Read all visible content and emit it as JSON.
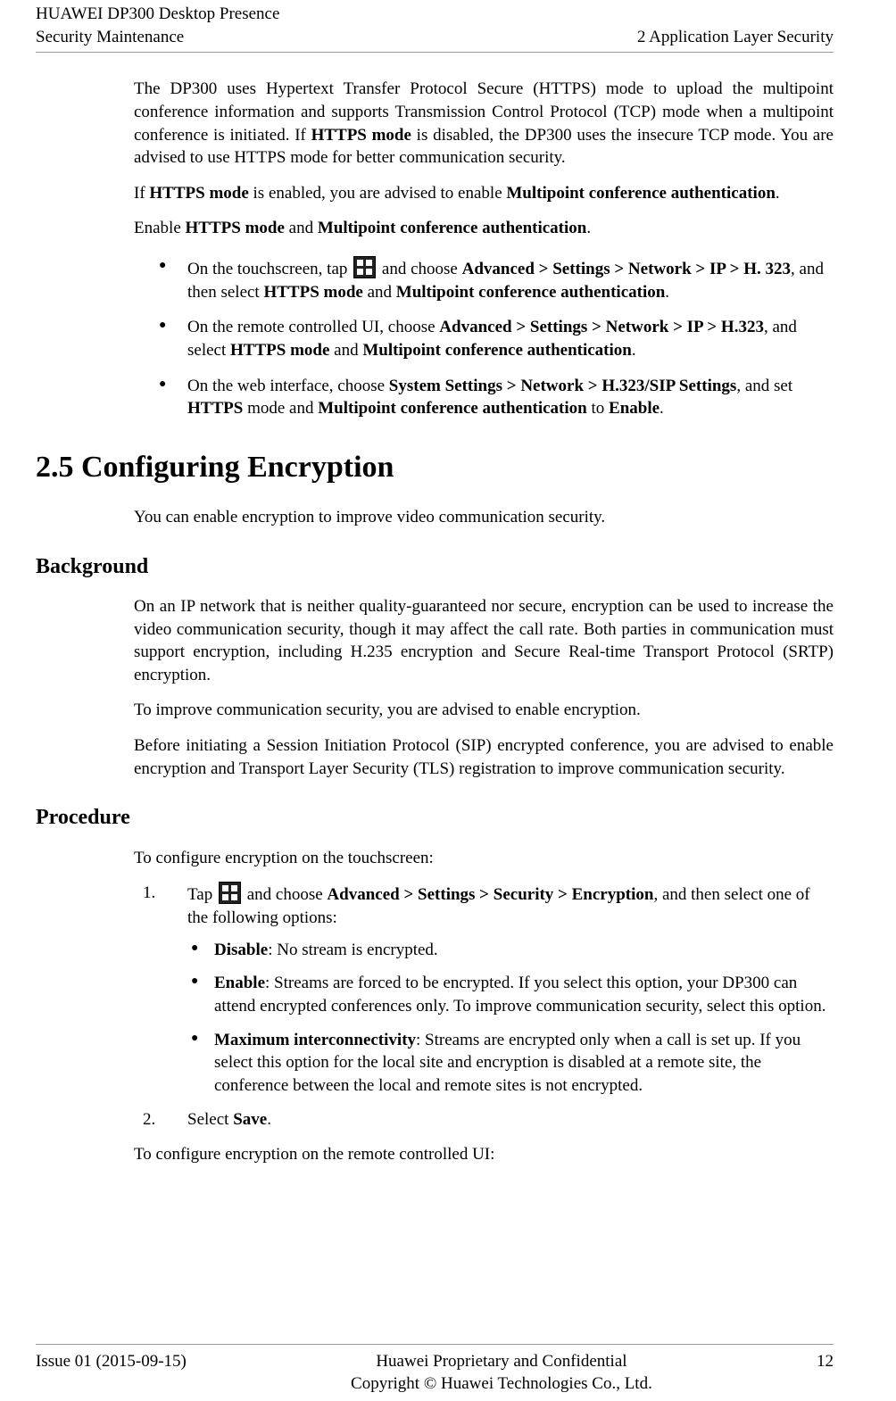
{
  "header": {
    "left_line1": "HUAWEI DP300 Desktop Presence",
    "left_line2": "Security Maintenance",
    "right": "2 Application Layer Security"
  },
  "para": {
    "p1_a": "The DP300 uses Hypertext Transfer Protocol Secure (HTTPS) mode to upload the multipoint conference information and supports Transmission Control Protocol (TCP) mode when a multipoint conference is initiated. If ",
    "p1_b_bold": "HTTPS mode",
    "p1_c": " is disabled, the DP300 uses the insecure TCP mode. You are advised to use HTTPS mode for better communication security.",
    "p2_a": "If ",
    "p2_b_bold": "HTTPS mode",
    "p2_c": " is enabled, you are advised to enable ",
    "p2_d_bold": "Multipoint conference authentication",
    "p2_e": ".",
    "p3_a": "Enable ",
    "p3_b_bold": "HTTPS mode",
    "p3_c": " and ",
    "p3_d_bold": "Multipoint conference authentication",
    "p3_e": "."
  },
  "bullets_top": {
    "b1_a": "On the touchscreen, tap ",
    "b1_b": " and choose ",
    "b1_nav": "Advanced > Settings > Network > IP > H. 323",
    "b1_c": ", and then select ",
    "b1_d_bold": "HTTPS mode",
    "b1_e": " and ",
    "b1_f_bold": "Multipoint conference authentication",
    "b1_g": ".",
    "b2_a": "On the remote controlled UI, choose ",
    "b2_nav": "Advanced > Settings > Network > IP > H.323",
    "b2_b": ", and select ",
    "b2_c_bold": "HTTPS mode",
    "b2_d": " and ",
    "b2_e_bold": "Multipoint conference authentication",
    "b2_f": ".",
    "b3_a": "On the web interface, choose ",
    "b3_nav": "System Settings > Network > H.323/SIP Settings",
    "b3_b": ", and set ",
    "b3_c_bold": "HTTPS",
    "b3_d": " mode and ",
    "b3_e_bold": "Multipoint conference authentication",
    "b3_f": " to ",
    "b3_g_bold": "Enable",
    "b3_h": "."
  },
  "section": {
    "title": "2.5 Configuring Encryption",
    "intro": "You can enable encryption to improve video communication security."
  },
  "background": {
    "heading": "Background",
    "p1": "On an IP network that is neither quality-guaranteed nor secure, encryption can be used to increase the video communication security, though it may affect the call rate. Both parties in communication must support encryption, including H.235 encryption and Secure Real-time Transport Protocol (SRTP) encryption.",
    "p2": "To improve communication security, you are advised to enable encryption.",
    "p3": "Before initiating a Session Initiation Protocol (SIP) encrypted conference, you are advised to enable encryption and Transport Layer Security (TLS) registration to improve communication security."
  },
  "procedure": {
    "heading": "Procedure",
    "intro": "To configure encryption on the touchscreen:",
    "step1_num": "1.",
    "step1_a": "Tap ",
    "step1_b": " and choose ",
    "step1_nav": "Advanced > Settings > Security > Encryption",
    "step1_c": ", and then select one of the following options:",
    "opt1_a": "Disable",
    "opt1_b": ": No stream is encrypted.",
    "opt2_a": "Enable",
    "opt2_b": ": Streams are forced to be encrypted. If you select this option, your DP300 can attend encrypted conferences only. To improve communication security, select this option.",
    "opt3_a": "Maximum interconnectivity",
    "opt3_b": ": Streams are encrypted only when a call is set up. If you select this option for the local site and encryption is disabled at a remote site, the conference between the local and remote sites is not encrypted.",
    "step2_num": "2.",
    "step2_a": "Select ",
    "step2_b_bold": "Save",
    "step2_c": ".",
    "outro": "To configure encryption on the remote controlled UI:"
  },
  "footer": {
    "left": "Issue 01 (2015-09-15)",
    "center1": "Huawei Proprietary and Confidential",
    "center2": "Copyright © Huawei Technologies Co., Ltd.",
    "right": "12"
  }
}
